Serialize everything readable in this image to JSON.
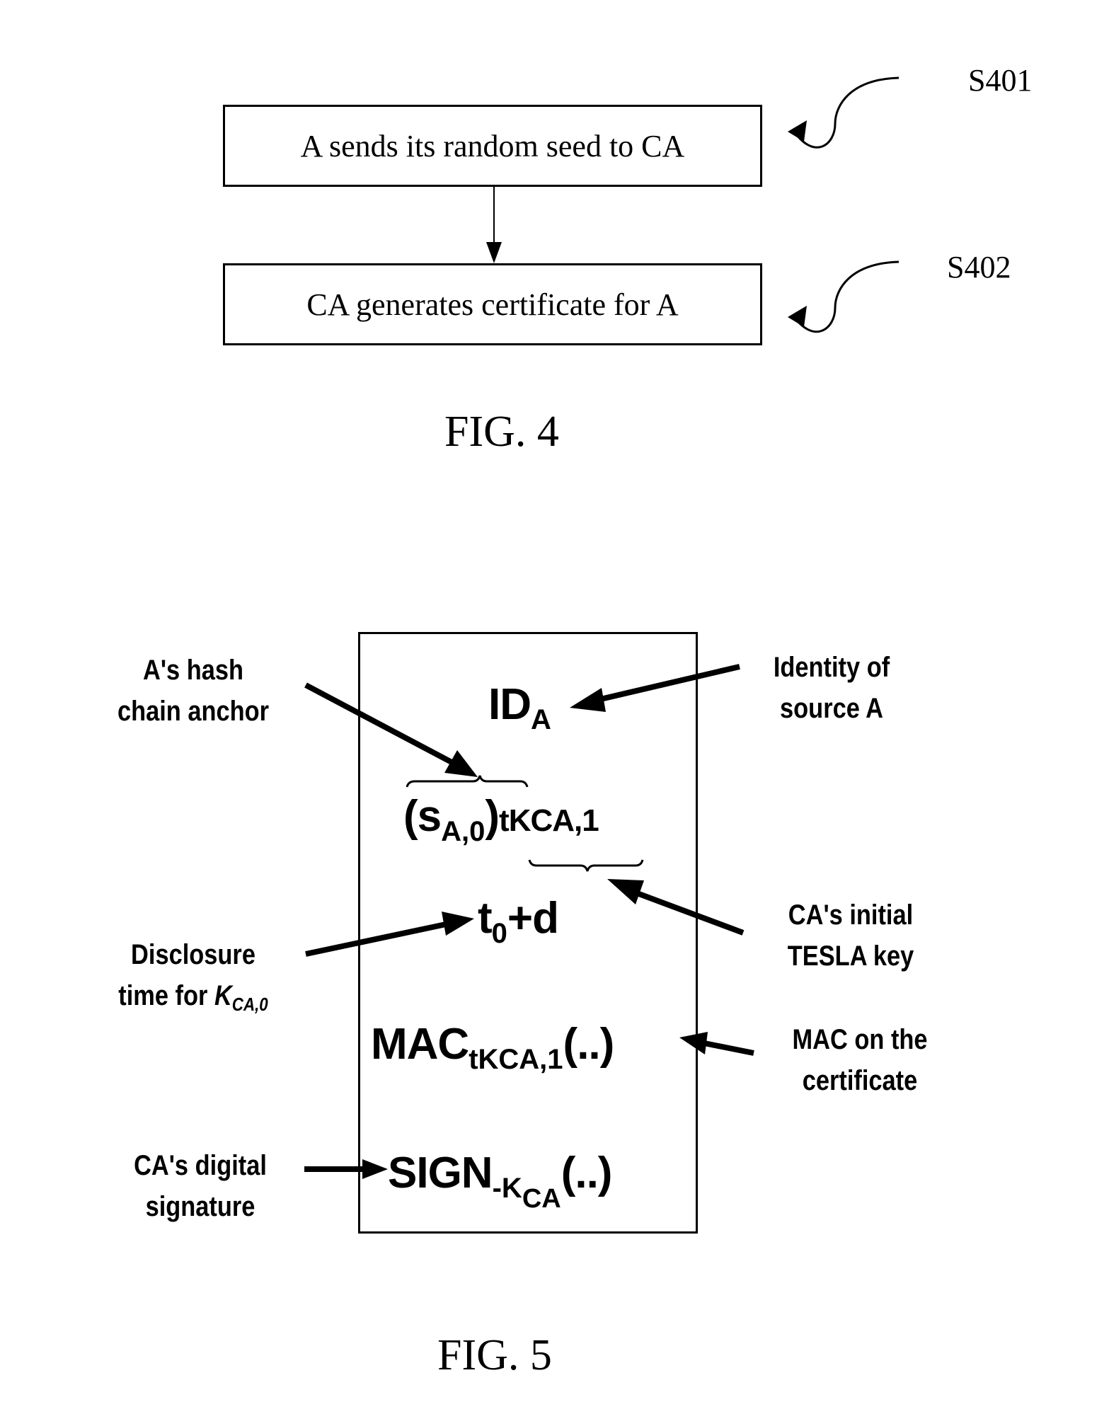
{
  "fig4": {
    "steps": [
      {
        "ref": "S401",
        "text": "A sends its random seed to CA"
      },
      {
        "ref": "S402",
        "text": "CA generates certificate for A"
      }
    ],
    "caption": "FIG. 4"
  },
  "fig5": {
    "certificate_fields": {
      "id": {
        "base": "ID",
        "sub": "A"
      },
      "anchor": {
        "open": "(",
        "base": "s",
        "sub": "A,0",
        "close": ")",
        "tail": "tKCA,1"
      },
      "disclosure": {
        "base": "t",
        "sub": "0",
        "tail": "+d"
      },
      "mac": {
        "base": "MAC",
        "sub": "tKCA,1",
        "tail": "(..)"
      },
      "sign": {
        "base": "SIGN",
        "sub": "-K",
        "subsub": "CA",
        "tail": "(..)"
      }
    },
    "annotations": {
      "hash_anchor": [
        "A's hash",
        "chain anchor"
      ],
      "identity": [
        "Identity of",
        "source A"
      ],
      "tesla_key": [
        "CA's initial",
        "TESLA key"
      ],
      "disclosure_line1": "Disclosure",
      "disclosure_line2_prefix": "time for ",
      "disclosure_key": "K",
      "disclosure_key_sub": "CA,0",
      "mac_note": [
        "MAC on the",
        "certificate"
      ],
      "signature": [
        "CA's digital",
        "signature"
      ]
    },
    "caption": "FIG. 5"
  }
}
